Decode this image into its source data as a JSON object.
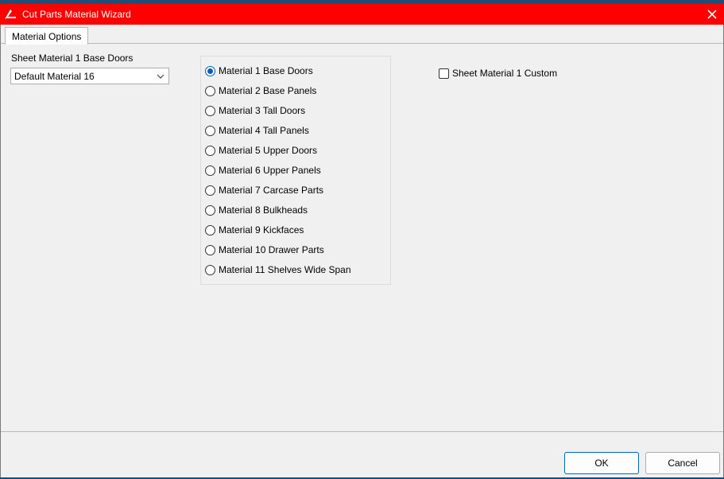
{
  "window": {
    "title": "Cut Parts Material Wizard",
    "accent_color": "#ff0000",
    "icon": "cabinet-app-icon",
    "close_icon": "close-icon"
  },
  "tabs": [
    {
      "label": "Material Options",
      "selected": true
    }
  ],
  "sheet_material": {
    "label": "Sheet Material 1  Base Doors",
    "dropdown_value": "Default Material 16"
  },
  "materials": {
    "selected_index": 0,
    "options": [
      {
        "label": "Material 1  Base Doors"
      },
      {
        "label": "Material 2  Base Panels"
      },
      {
        "label": "Material 3  Tall Doors"
      },
      {
        "label": "Material 4  Tall Panels"
      },
      {
        "label": "Material 5  Upper Doors"
      },
      {
        "label": "Material 6  Upper Panels"
      },
      {
        "label": "Material 7  Carcase Parts"
      },
      {
        "label": "Material 8  Bulkheads"
      },
      {
        "label": "Material 9  Kickfaces"
      },
      {
        "label": "Material 10  Drawer Parts"
      },
      {
        "label": "Material 11  Shelves Wide Span"
      }
    ]
  },
  "custom_checkbox": {
    "label": "Sheet Material 1 Custom",
    "checked": false
  },
  "buttons": {
    "ok": "OK",
    "cancel": "Cancel"
  }
}
